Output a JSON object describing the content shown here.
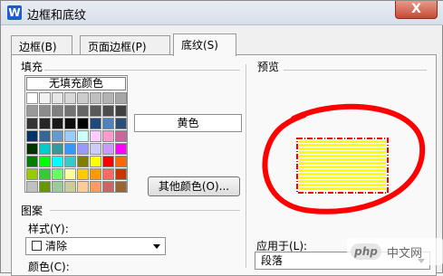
{
  "window": {
    "title": "边框和底纹",
    "app_icon_letter": "W",
    "close_glyph": "X"
  },
  "tabs": [
    {
      "label": "边框(B)"
    },
    {
      "label": "页面边框(P)"
    },
    {
      "label": "底纹(S)"
    }
  ],
  "fill": {
    "label": "填充",
    "no_fill_label": "无填充颜色",
    "selected_color_name": "黄色",
    "more_colors_label": "其他颜色(O)...",
    "swatch_colors": [
      [
        "#ffffff",
        "#f2f2f2",
        "#e6e6e6",
        "#d9d9d9",
        "#cccccc",
        "#bfbfbf",
        "#b3b3b3",
        "#a6a6a6"
      ],
      [
        "#999999",
        "#8c8c8c",
        "#808080",
        "#737373",
        "#666666",
        "#595959",
        "#4d4d4d",
        "#404040"
      ],
      [
        "#333333",
        "#262626",
        "#1a1a1a",
        "#0d0d0d",
        "#000000",
        "#1f497d",
        "#4f81bd",
        "#2c4d75"
      ],
      [
        "#003366",
        "#336699",
        "#6699cc",
        "#99ccff",
        "#ccffff",
        "#ffccff",
        "#ff99cc",
        "#cc6699"
      ],
      [
        "#003300",
        "#00cccc",
        "#339999",
        "#3399ff",
        "#9999ff",
        "#ccccff",
        "#cc99ff",
        "#ff00ff"
      ],
      [
        "#008000",
        "#00ff00",
        "#00ffff",
        "#33cccc",
        "#808000",
        "#ffff00",
        "#ff0000",
        "#ff6600"
      ],
      [
        "#99cc00",
        "#33cc33",
        "#66ff66",
        "#ffff99",
        "#ffcc00",
        "#ff9900",
        "#ff6666",
        "#cc3300"
      ],
      [
        "#c0c0c0",
        "#669900",
        "#99cc99",
        "#cccc99",
        "#ffcc99",
        "#ff9966",
        "#cc6666",
        "#996633"
      ]
    ]
  },
  "pattern": {
    "label": "图案",
    "style_label": "样式(Y):",
    "style_value": "清除",
    "color_label": "颜色(C):"
  },
  "preview": {
    "label": "预览",
    "apply_to_label": "应用于(L):",
    "apply_to_value": "段落",
    "fill_color": "#ffff00",
    "border_color": "#ff0000",
    "circle_color": "#ff0000"
  },
  "watermark": {
    "logo": "php",
    "text": "中文网"
  }
}
